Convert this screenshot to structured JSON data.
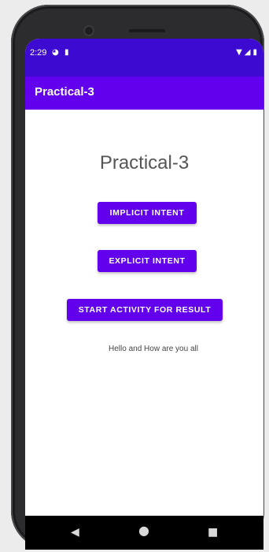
{
  "status_bar": {
    "time": "2:29",
    "left_icons": [
      "pie-chart-icon",
      "sd-card-icon"
    ],
    "right_icons": [
      "wifi-icon",
      "signal-icon",
      "battery-icon"
    ]
  },
  "app_bar": {
    "title": "Practical-3"
  },
  "main": {
    "heading": "Practical-3",
    "buttons": {
      "implicit": "IMPLICIT INTENT",
      "explicit": "EXPLICIT INTENT",
      "result": "START ACTIVITY FOR RESULT"
    },
    "message": "Hello and How are you all"
  },
  "nav_bar": {
    "icons": [
      "back-icon",
      "home-icon",
      "recents-icon"
    ]
  },
  "colors": {
    "status_bar": "#3c0ad0",
    "app_bar": "#6200ee",
    "button": "#6200ee"
  }
}
